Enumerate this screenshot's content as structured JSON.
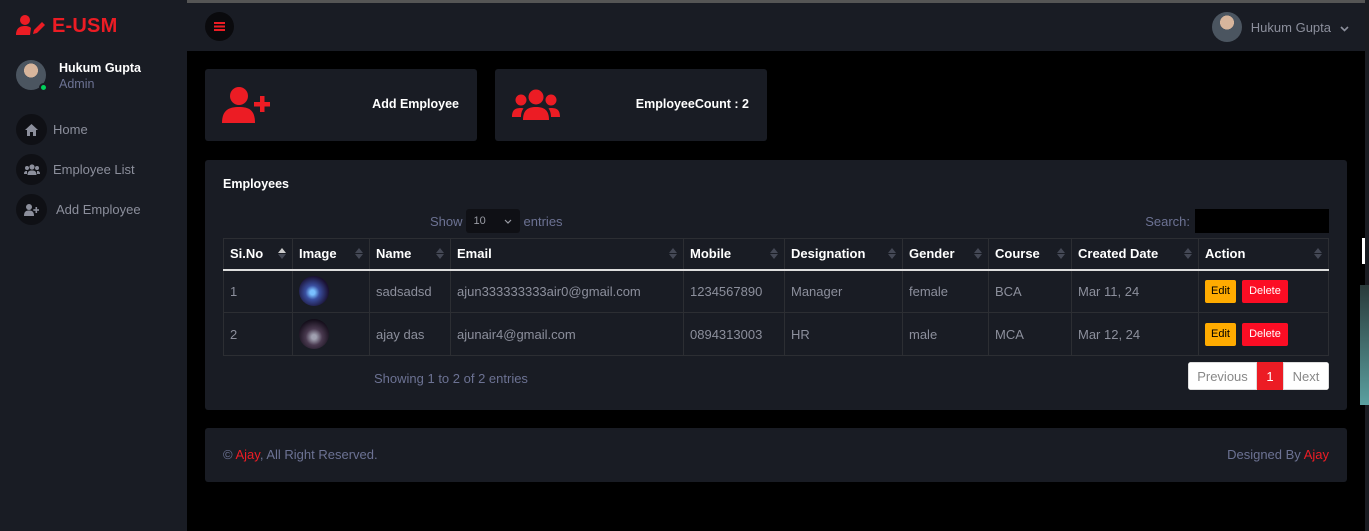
{
  "brand": {
    "name": "E-USM",
    "color": "#ec1c24"
  },
  "profile": {
    "name": "Hukum Gupta",
    "role": "Admin"
  },
  "nav": [
    {
      "label": "Home",
      "icon": "home-icon"
    },
    {
      "label": "Employee List",
      "icon": "users-icon"
    },
    {
      "label": "Add Employee",
      "icon": "user-plus-icon"
    }
  ],
  "topbar": {
    "user_name": "Hukum Gupta"
  },
  "cards": {
    "add_employee": "Add Employee",
    "employee_count": "EmployeeCount : 2"
  },
  "panel": {
    "title": "Employees",
    "show_label": "Show",
    "page_size": "10",
    "entries_label": "entries",
    "search_label": "Search:",
    "columns": [
      "Si.No",
      "Image",
      "Name",
      "Email",
      "Mobile",
      "Designation",
      "Gender",
      "Course",
      "Created Date",
      "Action"
    ],
    "rows": [
      {
        "sino": "1",
        "name": "sadsadsd",
        "email": "ajun333333333air0@gmail.com",
        "mobile": "1234567890",
        "designation": "Manager",
        "gender": "female",
        "course": "BCA",
        "created": "Mar 11, 24"
      },
      {
        "sino": "2",
        "name": "ajay das",
        "email": "ajunair4@gmail.com",
        "mobile": "0894313003",
        "designation": "HR",
        "gender": "male",
        "course": "MCA",
        "created": "Mar 12, 24"
      }
    ],
    "edit_label": "Edit",
    "delete_label": "Delete",
    "info": "Showing 1 to 2 of 2 entries",
    "pager": {
      "prev": "Previous",
      "current": "1",
      "next": "Next"
    }
  },
  "footer": {
    "copy_symbol": "©",
    "author": "Ajay",
    "rights": ", All Right Reserved.",
    "designed_by": "Designed By",
    "designer": "Ajay"
  }
}
